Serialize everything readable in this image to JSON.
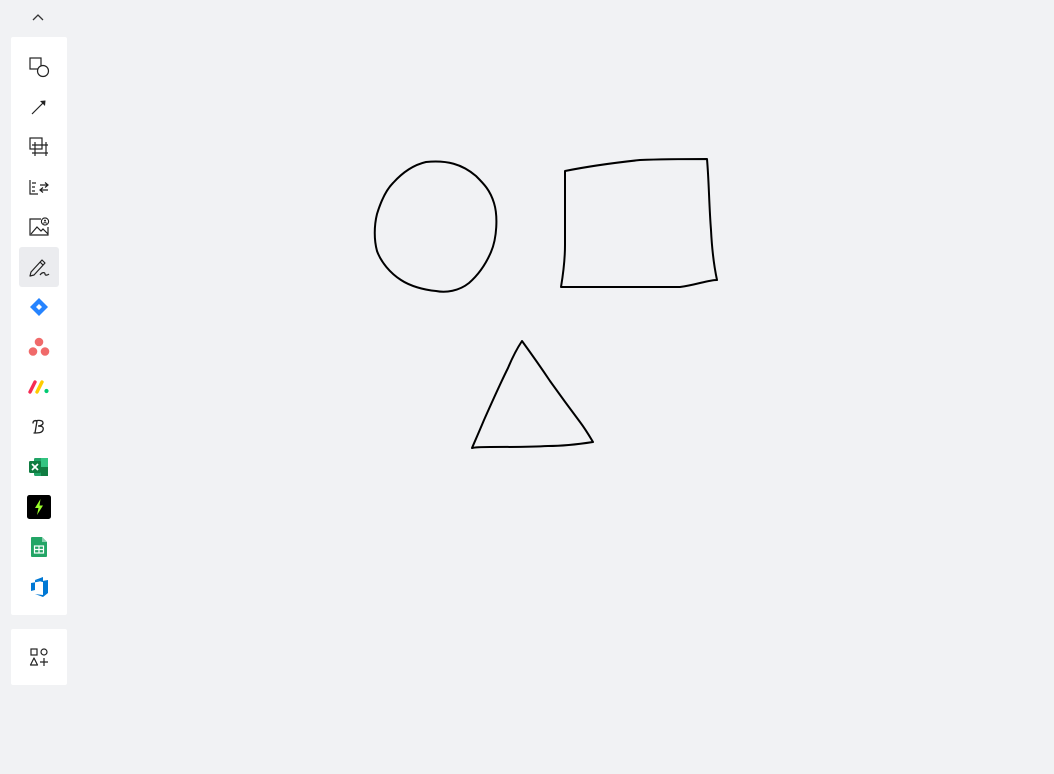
{
  "toolbar": {
    "collapse": {
      "icon": "chevron-up-icon"
    },
    "tools": [
      {
        "id": "shapes",
        "icon": "square-circle-shapes-icon",
        "active": false
      },
      {
        "id": "connection-line",
        "icon": "arrow-line-icon",
        "active": false
      },
      {
        "id": "frame",
        "icon": "frame-icon",
        "active": false
      },
      {
        "id": "structured-text",
        "icon": "text-swap-icon",
        "active": false
      },
      {
        "id": "image-upload",
        "icon": "image-icon",
        "active": false
      },
      {
        "id": "pen",
        "icon": "pen-icon",
        "active": true
      },
      {
        "id": "jira",
        "icon": "jira-logo-icon",
        "color": "#2684ff",
        "active": false
      },
      {
        "id": "asana",
        "icon": "asana-logo-icon",
        "color": "#f06a6a",
        "active": false
      },
      {
        "id": "monday",
        "icon": "monday-logo-icon",
        "active": false
      },
      {
        "id": "b-app",
        "icon": "script-b-icon",
        "active": false
      },
      {
        "id": "excel",
        "icon": "excel-logo-icon",
        "color": "#107c41",
        "active": false
      },
      {
        "id": "zapier-bolt",
        "icon": "bolt-app-icon",
        "color": "#000000",
        "active": false
      },
      {
        "id": "google-sheets",
        "icon": "google-sheets-logo-icon",
        "color": "#23a566",
        "active": false
      },
      {
        "id": "azure-devops",
        "icon": "azure-devops-logo-icon",
        "color": "#0078d4",
        "active": false
      }
    ],
    "more": {
      "icon": "more-apps-icon"
    }
  },
  "board": {
    "stroke_color": "#000000",
    "drawings": [
      {
        "shape": "circle"
      },
      {
        "shape": "rectangle"
      },
      {
        "shape": "triangle"
      }
    ]
  }
}
